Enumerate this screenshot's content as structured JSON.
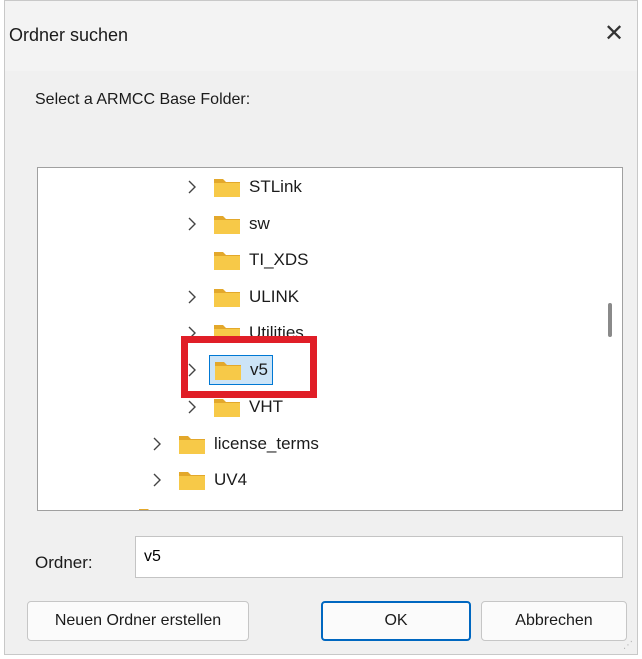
{
  "dialog": {
    "title": "Ordner suchen",
    "close_glyph": "✕",
    "prompt": "Select a ARMCC Base Folder:"
  },
  "tree": {
    "items": [
      {
        "label": "STLink",
        "expandable": true,
        "selected": false
      },
      {
        "label": "sw",
        "expandable": true,
        "selected": false
      },
      {
        "label": "TI_XDS",
        "expandable": false,
        "selected": false
      },
      {
        "label": "ULINK",
        "expandable": true,
        "selected": false
      },
      {
        "label": "Utilities",
        "expandable": true,
        "selected": false
      },
      {
        "label": "v5",
        "expandable": true,
        "selected": true
      },
      {
        "label": "VHT",
        "expandable": true,
        "selected": false
      },
      {
        "label": "license_terms",
        "expandable": true,
        "selected": false
      },
      {
        "label": "UV4",
        "expandable": true,
        "selected": false
      }
    ]
  },
  "folder_field": {
    "label": "Ordner:",
    "value": "v5"
  },
  "buttons": {
    "new_folder": "Neuen Ordner erstellen",
    "ok": "OK",
    "cancel": "Abbrechen"
  },
  "colors": {
    "folder": "#f7c948",
    "folder_dark": "#e3a82b",
    "highlight": "#e01e27",
    "accent": "#0067c0"
  },
  "icons": {
    "expand": "chevron-right-icon",
    "folder": "folder-icon",
    "close": "close-icon"
  }
}
